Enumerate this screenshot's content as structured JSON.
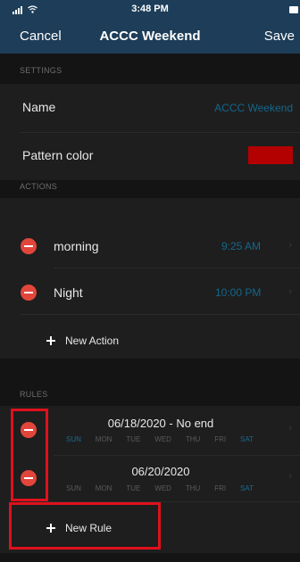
{
  "status_bar": {
    "time": "3:48 PM"
  },
  "nav": {
    "cancel_label": "Cancel",
    "title": "ACCC Weekend",
    "save_label": "Save"
  },
  "settings": {
    "header": "SETTINGS",
    "name_label": "Name",
    "name_value": "ACCC Weekend",
    "pattern_color_label": "Pattern color",
    "pattern_color": "#b30000"
  },
  "actions": {
    "header": "ACTIONS",
    "items": [
      {
        "name": "morning",
        "time": "9:25 AM"
      },
      {
        "name": "Night",
        "time": "10:00 PM"
      }
    ],
    "new_label": "New Action"
  },
  "rules": {
    "header": "RULES",
    "day_labels": [
      "SUN",
      "MON",
      "TUE",
      "WED",
      "THU",
      "FRI",
      "SAT"
    ],
    "items": [
      {
        "title": "06/18/2020 - No end",
        "active_days": [
          "SUN",
          "SAT"
        ]
      },
      {
        "title": "06/20/2020",
        "active_days": [
          "SAT"
        ]
      }
    ],
    "new_label": "New Rule"
  },
  "colors": {
    "nav_background": "#1d3d58",
    "accent": "#14678b",
    "delete_button": "#e2463b",
    "highlight": "#e0101c"
  },
  "icons": [
    "signal-icon",
    "wifi-icon",
    "battery-icon",
    "minus-circle-icon",
    "plus-icon",
    "chevron-right-icon"
  ]
}
